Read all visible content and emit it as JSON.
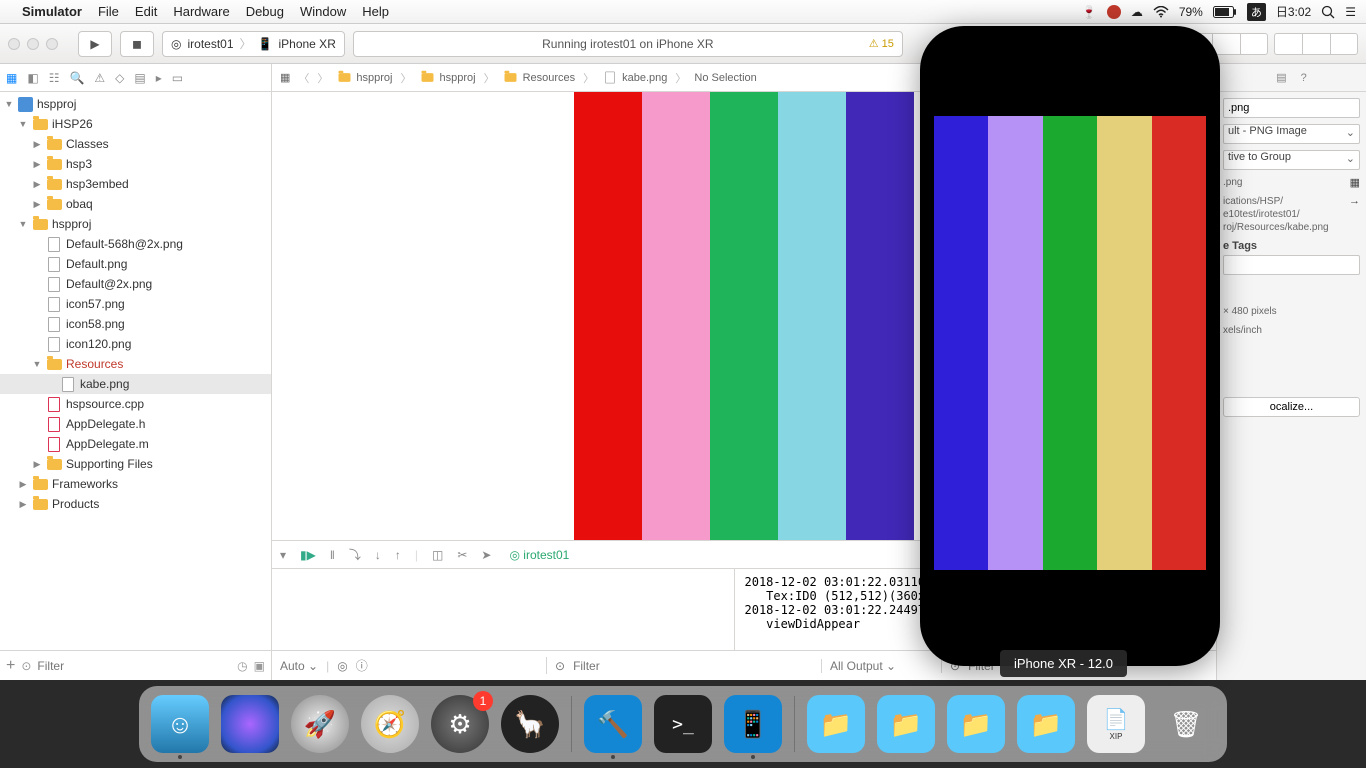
{
  "menubar": {
    "app": "Simulator",
    "items": [
      "File",
      "Edit",
      "Hardware",
      "Debug",
      "Window",
      "Help"
    ],
    "battery": "79%",
    "input": "あ",
    "clock_prefix": "日",
    "clock": "3:02"
  },
  "xcode": {
    "scheme_target": "irotest01",
    "scheme_device": "iPhone XR",
    "activity": "Running irotest01 on iPhone XR",
    "warn_count": "15",
    "breadcrumb": [
      "hspproj",
      "hspproj",
      "Resources",
      "kabe.png",
      "No Selection"
    ],
    "nav_filter_placeholder": "Filter",
    "tree": {
      "root": "hspproj",
      "ihsp": "iHSP26",
      "classes": "Classes",
      "hsp3": "hsp3",
      "hsp3embed": "hsp3embed",
      "obaq": "obaq",
      "hspproj": "hspproj",
      "files": [
        "Default-568h@2x.png",
        "Default.png",
        "Default@2x.png",
        "icon57.png",
        "icon58.png",
        "icon120.png"
      ],
      "resources": "Resources",
      "kabe": "kabe.png",
      "hspsource": "hspsource.cpp",
      "appdelegate_h": "AppDelegate.h",
      "appdelegate_m": "AppDelegate.m",
      "supporting": "Supporting Files",
      "frameworks": "Frameworks",
      "products": "Products"
    },
    "debug": {
      "target": "irotest01",
      "auto": "Auto",
      "all_output": "All Output",
      "filter_placeholder": "Filter",
      "console": "2018-12-02 03:01:22.031106+0900\n   Tex:ID0 (512,512)(360x480)\n2018-12-02 03:01:22.244973+0900\n   viewDidAppear"
    },
    "inspector": {
      "name": ".png",
      "type": "ult - PNG Image",
      "location": "tive to Group",
      "relpath": ".png",
      "fullpath": "ications/HSP/\ne10test/irotest01/\nroj/Resources/kabe.png",
      "tags_label": "e Tags",
      "dims": "× 480 pixels",
      "dpi": "xels/inch",
      "localize": "ocalize..."
    },
    "colors": [
      "#e80d0d",
      "#f69acb",
      "#1fb35a",
      "#87d6e3",
      "#4128b7"
    ],
    "sim_colors": [
      "#2f1fd9",
      "#b692f6",
      "#1ba92f",
      "#e4d07a",
      "#d92b24"
    ]
  },
  "simulator_tip": "iPhone XR - 12.0",
  "dock": {
    "badge": "1",
    "xip": "XIP"
  }
}
